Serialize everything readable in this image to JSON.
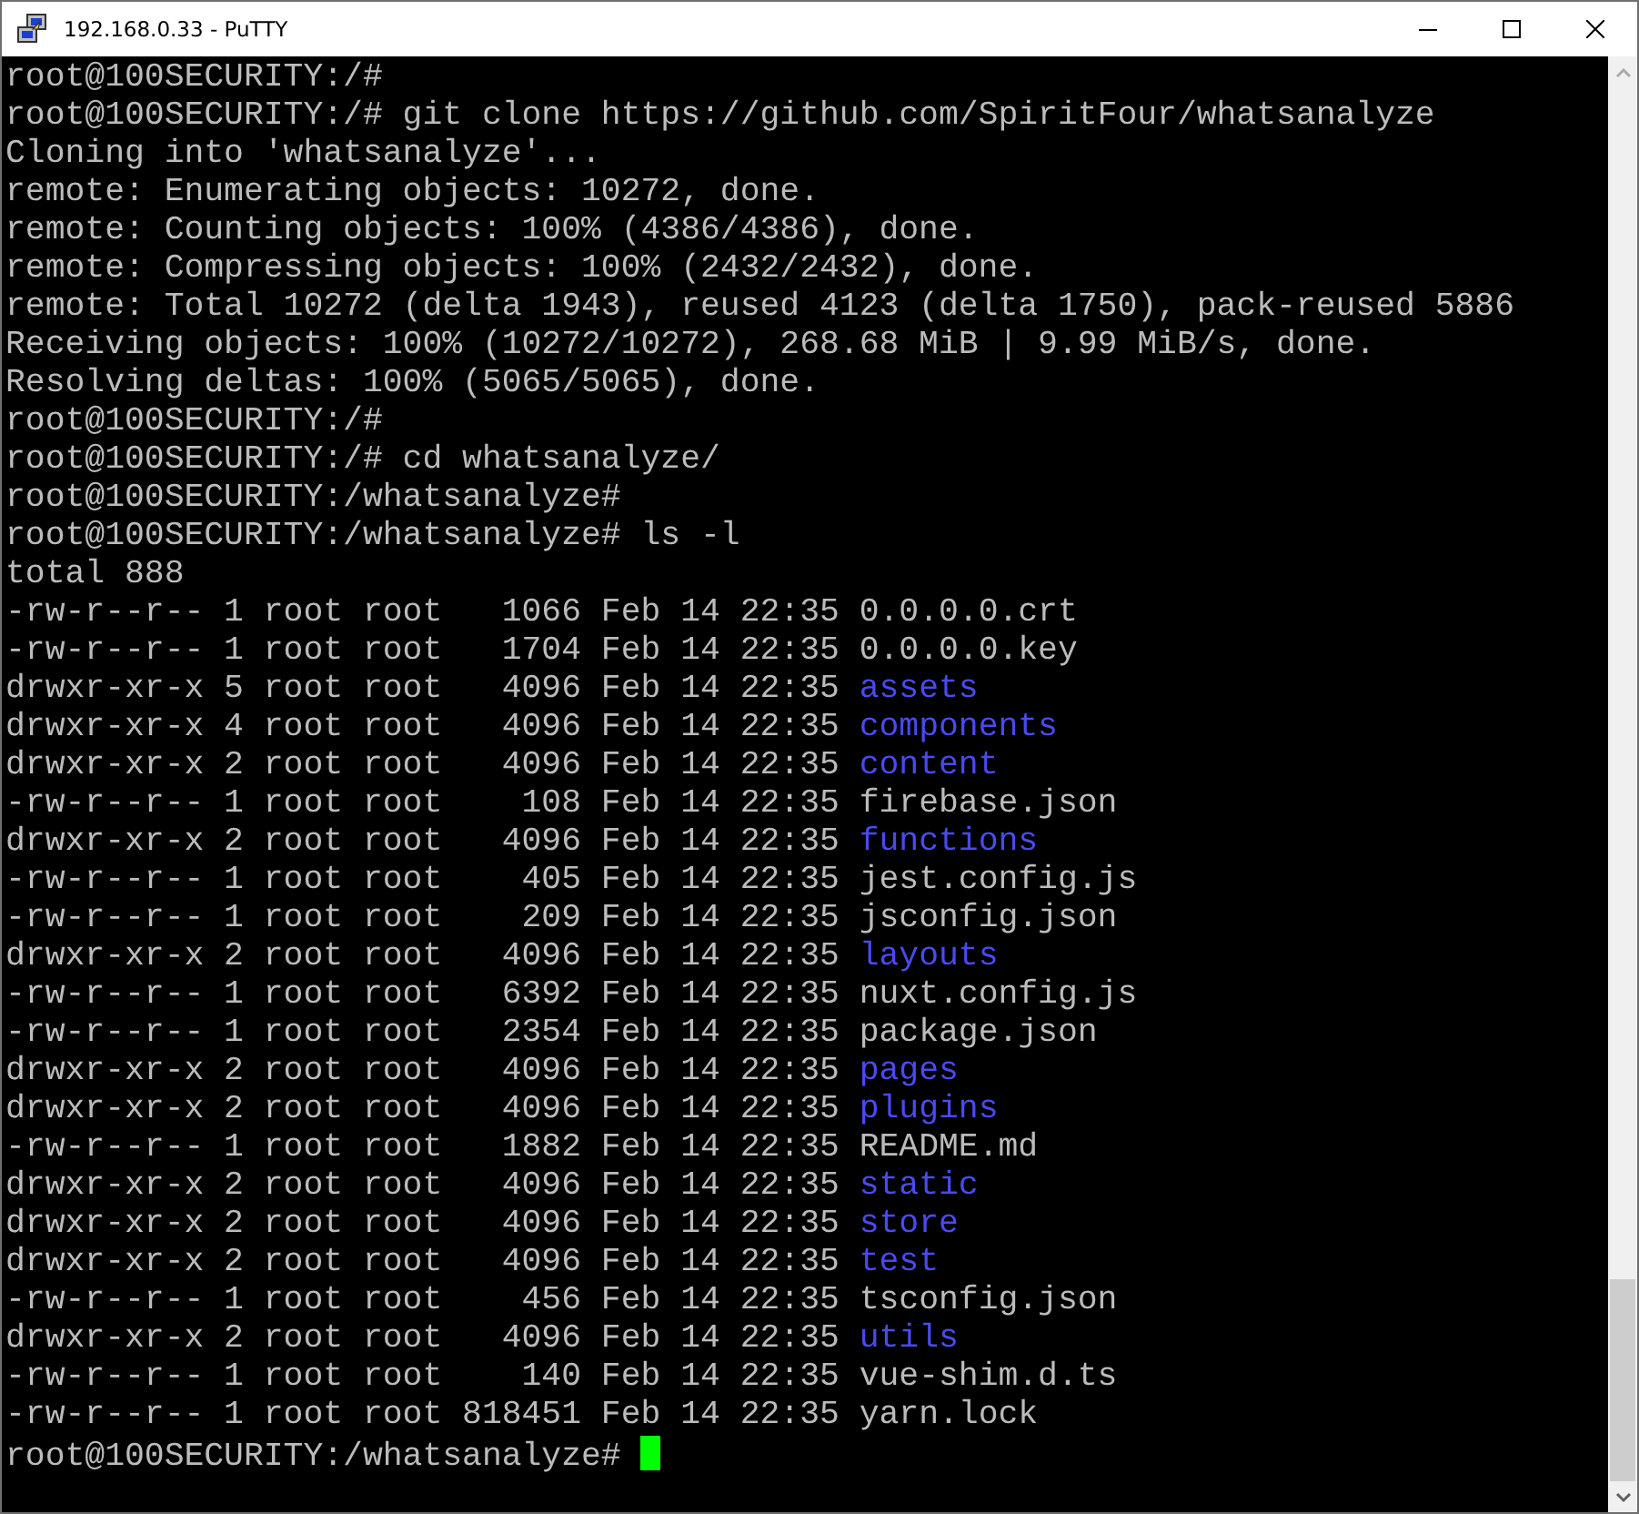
{
  "window": {
    "title": "192.168.0.33 - PuTTY"
  },
  "terminal": {
    "lines": [
      {
        "kind": "text",
        "text": "root@100SECURITY:/#"
      },
      {
        "kind": "text",
        "text": "root@100SECURITY:/# git clone https://github.com/SpiritFour/whatsanalyze"
      },
      {
        "kind": "text",
        "text": "Cloning into 'whatsanalyze'..."
      },
      {
        "kind": "text",
        "text": "remote: Enumerating objects: 10272, done."
      },
      {
        "kind": "text",
        "text": "remote: Counting objects: 100% (4386/4386), done."
      },
      {
        "kind": "text",
        "text": "remote: Compressing objects: 100% (2432/2432), done."
      },
      {
        "kind": "text",
        "text": "remote: Total 10272 (delta 1943), reused 4123 (delta 1750), pack-reused 5886"
      },
      {
        "kind": "text",
        "text": "Receiving objects: 100% (10272/10272), 268.68 MiB | 9.99 MiB/s, done."
      },
      {
        "kind": "text",
        "text": "Resolving deltas: 100% (5065/5065), done."
      },
      {
        "kind": "text",
        "text": "root@100SECURITY:/#"
      },
      {
        "kind": "text",
        "text": "root@100SECURITY:/# cd whatsanalyze/"
      },
      {
        "kind": "text",
        "text": "root@100SECURITY:/whatsanalyze#"
      },
      {
        "kind": "text",
        "text": "root@100SECURITY:/whatsanalyze# ls -l"
      },
      {
        "kind": "text",
        "text": "total 888"
      },
      {
        "kind": "entry",
        "info": "-rw-r--r-- 1 root root   1066 Feb 14 22:35",
        "name": "0.0.0.0.crt",
        "directory": false
      },
      {
        "kind": "entry",
        "info": "-rw-r--r-- 1 root root   1704 Feb 14 22:35",
        "name": "0.0.0.0.key",
        "directory": false
      },
      {
        "kind": "entry",
        "info": "drwxr-xr-x 5 root root   4096 Feb 14 22:35",
        "name": "assets",
        "directory": true
      },
      {
        "kind": "entry",
        "info": "drwxr-xr-x 4 root root   4096 Feb 14 22:35",
        "name": "components",
        "directory": true
      },
      {
        "kind": "entry",
        "info": "drwxr-xr-x 2 root root   4096 Feb 14 22:35",
        "name": "content",
        "directory": true
      },
      {
        "kind": "entry",
        "info": "-rw-r--r-- 1 root root    108 Feb 14 22:35",
        "name": "firebase.json",
        "directory": false
      },
      {
        "kind": "entry",
        "info": "drwxr-xr-x 2 root root   4096 Feb 14 22:35",
        "name": "functions",
        "directory": true
      },
      {
        "kind": "entry",
        "info": "-rw-r--r-- 1 root root    405 Feb 14 22:35",
        "name": "jest.config.js",
        "directory": false
      },
      {
        "kind": "entry",
        "info": "-rw-r--r-- 1 root root    209 Feb 14 22:35",
        "name": "jsconfig.json",
        "directory": false
      },
      {
        "kind": "entry",
        "info": "drwxr-xr-x 2 root root   4096 Feb 14 22:35",
        "name": "layouts",
        "directory": true
      },
      {
        "kind": "entry",
        "info": "-rw-r--r-- 1 root root   6392 Feb 14 22:35",
        "name": "nuxt.config.js",
        "directory": false
      },
      {
        "kind": "entry",
        "info": "-rw-r--r-- 1 root root   2354 Feb 14 22:35",
        "name": "package.json",
        "directory": false
      },
      {
        "kind": "entry",
        "info": "drwxr-xr-x 2 root root   4096 Feb 14 22:35",
        "name": "pages",
        "directory": true
      },
      {
        "kind": "entry",
        "info": "drwxr-xr-x 2 root root   4096 Feb 14 22:35",
        "name": "plugins",
        "directory": true
      },
      {
        "kind": "entry",
        "info": "-rw-r--r-- 1 root root   1882 Feb 14 22:35",
        "name": "README.md",
        "directory": false
      },
      {
        "kind": "entry",
        "info": "drwxr-xr-x 2 root root   4096 Feb 14 22:35",
        "name": "static",
        "directory": true
      },
      {
        "kind": "entry",
        "info": "drwxr-xr-x 2 root root   4096 Feb 14 22:35",
        "name": "store",
        "directory": true
      },
      {
        "kind": "entry",
        "info": "drwxr-xr-x 2 root root   4096 Feb 14 22:35",
        "name": "test",
        "directory": true
      },
      {
        "kind": "entry",
        "info": "-rw-r--r-- 1 root root    456 Feb 14 22:35",
        "name": "tsconfig.json",
        "directory": false
      },
      {
        "kind": "entry",
        "info": "drwxr-xr-x 2 root root   4096 Feb 14 22:35",
        "name": "utils",
        "directory": true
      },
      {
        "kind": "entry",
        "info": "-rw-r--r-- 1 root root    140 Feb 14 22:35",
        "name": "vue-shim.d.ts",
        "directory": false
      },
      {
        "kind": "entry",
        "info": "-rw-r--r-- 1 root root 818451 Feb 14 22:35",
        "name": "yarn.lock",
        "directory": false
      },
      {
        "kind": "prompt",
        "text": "root@100SECURITY:/whatsanalyze#",
        "cursor": true
      }
    ]
  }
}
